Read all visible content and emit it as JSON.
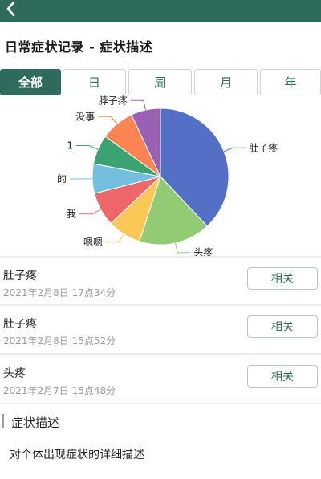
{
  "header": {
    "back_icon": "back-chevron-icon",
    "bar_color": "#2e6b5c"
  },
  "page_title": "日常症状记录 - 症状描述",
  "tabs": [
    {
      "label": "全部",
      "active": true
    },
    {
      "label": "日",
      "active": false
    },
    {
      "label": "周",
      "active": false
    },
    {
      "label": "月",
      "active": false
    },
    {
      "label": "年",
      "active": false
    }
  ],
  "chart_data": {
    "type": "pie",
    "slices": [
      {
        "label": "肚子疼",
        "value": 38,
        "color": "#5470c6"
      },
      {
        "label": "头疼",
        "value": 17,
        "color": "#91cc75"
      },
      {
        "label": "嗯嗯",
        "value": 8,
        "color": "#fac858"
      },
      {
        "label": "我",
        "value": 8,
        "color": "#ee6666"
      },
      {
        "label": "的",
        "value": 7,
        "color": "#73c0de"
      },
      {
        "label": "1",
        "value": 7,
        "color": "#3ba272"
      },
      {
        "label": "没事",
        "value": 8,
        "color": "#fc8452"
      },
      {
        "label": "脖子疼",
        "value": 7,
        "color": "#9a60b4"
      }
    ]
  },
  "records": [
    {
      "title": "肚子疼",
      "time": "2021年2月8日 17点34分",
      "button_label": "相关"
    },
    {
      "title": "肚子疼",
      "time": "2021年2月8日 15点52分",
      "button_label": "相关"
    },
    {
      "title": "头疼",
      "time": "2021年2月7日 15点48分",
      "button_label": "相关"
    }
  ],
  "section": {
    "title": "症状描述",
    "description": "对个体出现症状的详细描述"
  }
}
